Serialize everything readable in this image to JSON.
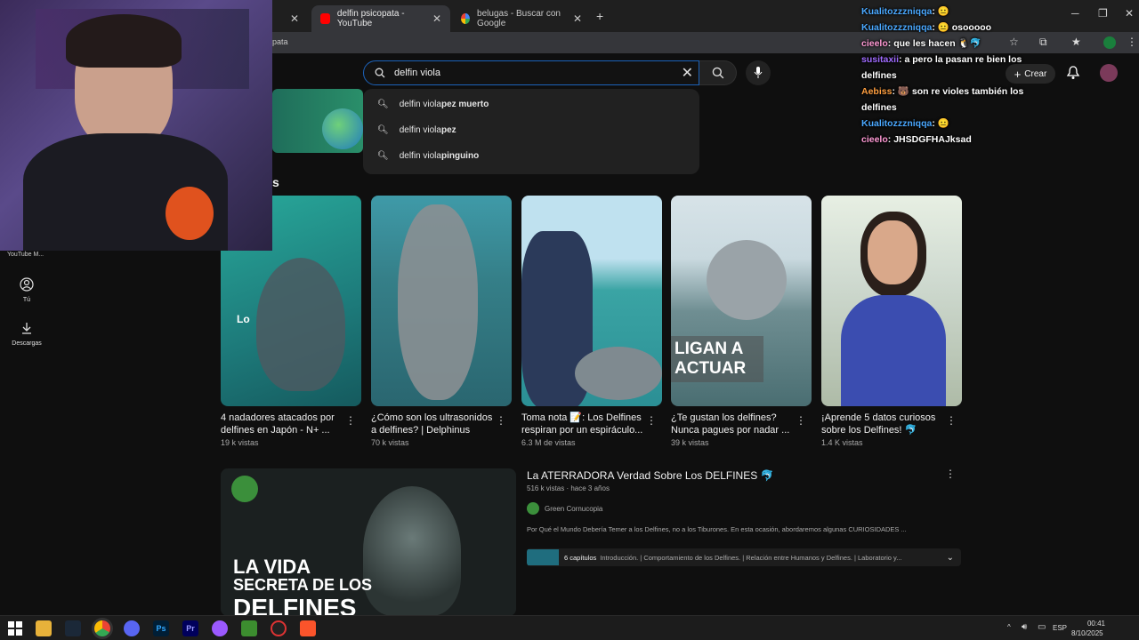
{
  "browser": {
    "tabs": [
      {
        "label": ""
      },
      {
        "label": "delfin psicopata - YouTube"
      },
      {
        "label": "belugas - Buscar con Google"
      }
    ],
    "new_tab_symbol": "+",
    "address_fragment": "pata"
  },
  "youtube": {
    "search_value": "delfin viola",
    "suggestions": [
      {
        "prefix": "delfin viola ",
        "rest": "pez muerto"
      },
      {
        "prefix": "delfin viola ",
        "rest": "pez"
      },
      {
        "prefix": "delfin viola ",
        "rest": "pinguino"
      }
    ],
    "create_label": "Crear",
    "shelf_title_fragment": "s",
    "sidebar": [
      {
        "label": "Tú",
        "icon": "user-circle-icon"
      },
      {
        "label": "Descargas",
        "icon": "download-icon"
      }
    ],
    "shorts": [
      {
        "title": "4 nadadores atacados por delfines en Japón - N+ ...",
        "views": "19 k vistas",
        "overlay": "Lo"
      },
      {
        "title": "¿Cómo son los ultrasonidos a delfines? | Delphinus",
        "views": "70 k vistas",
        "overlay": ""
      },
      {
        "title": "Toma nota 📝: Los Delfines respiran por un espiráculo...",
        "views": "6.3 M de vistas",
        "overlay": ""
      },
      {
        "title": "¿Te gustan los delfines? Nunca pagues por nadar ...",
        "views": "39 k vistas",
        "overlay": "LIGAN A ACTUAR"
      },
      {
        "title": "¡Aprende 5 datos curiosos sobre los Delfines! 🐬",
        "views": "1.4 K vistas",
        "overlay": ""
      }
    ],
    "video": {
      "title": "La ATERRADORA Verdad Sobre Los DELFINES 🐬",
      "meta": "516 k vistas · hace 3 años",
      "channel": "Green Cornucopia",
      "description": "Por Qué el Mundo Debería Temer a los Delfines, no a los Tiburones. En esta ocasión, abordaremos algunas CURIOSIDADES ...",
      "chapters_count": "6 capítulos",
      "chapters_text": "Introducción. | Comportamiento de los Delfines. | Relación entre Humanos y Delfines. | Laboratorio y...",
      "thumb_text_line1": "LA VIDA",
      "thumb_text_line2": "SECRETA DE LOS",
      "thumb_text_line3": "DELFINES"
    }
  },
  "stream_overlay": {
    "webcam_label": "YouTube M...",
    "chat": [
      {
        "user": "Kualitozzzniqqa",
        "user_color": "#4aa8ff",
        "text": "😐"
      },
      {
        "user": "Kualitozzzniqqa",
        "user_color": "#4aa8ff",
        "text": "😐 osooooo"
      },
      {
        "user": "cieelo",
        "user_color": "#ff9ad5",
        "text": "que les hacen 🐧🐬"
      },
      {
        "user": "susitaxii",
        "user_color": "#a06bff",
        "text": "a pero la pasan re bien los delfines"
      },
      {
        "user": "Aebiss",
        "user_color": "#ff9f40",
        "text": "🐻 son re violes también los delfines"
      },
      {
        "user": "Kualitozzzniqqa",
        "user_color": "#4aa8ff",
        "text": "😐"
      },
      {
        "user": "cieelo",
        "user_color": "#ff9ad5",
        "text": "JHSDGFHAJksad"
      }
    ]
  },
  "taskbar": {
    "lang": "ESP",
    "time": "00:41",
    "date": "8/10/2025"
  },
  "colors": {
    "accent_blue": "#1c62b9",
    "yt_background": "#0f0f0f"
  }
}
